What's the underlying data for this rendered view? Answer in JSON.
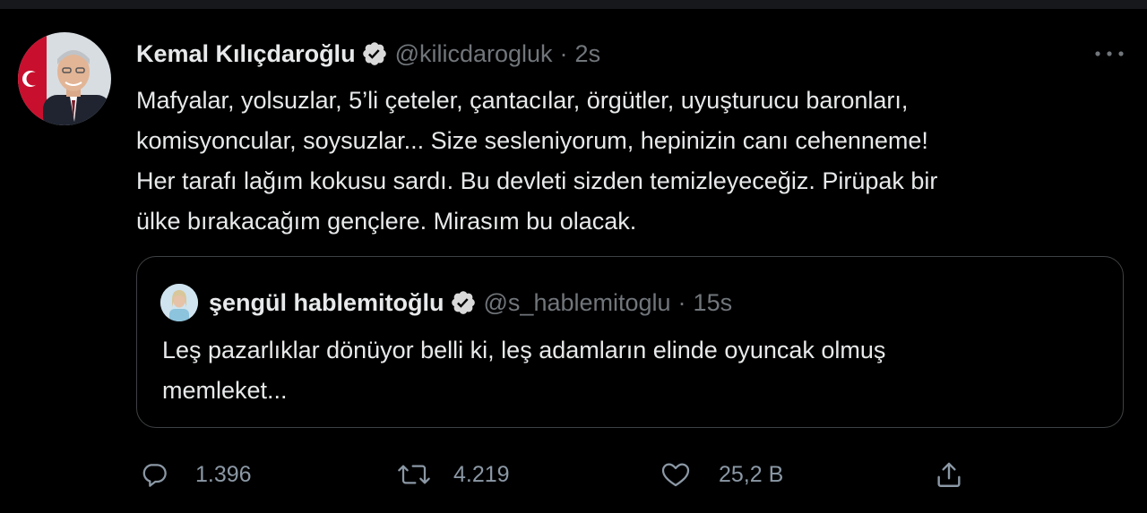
{
  "tweet": {
    "author_name": "Kemal Kılıçdaroğlu",
    "handle": "@kilicdarogluk",
    "separator": "·",
    "time": "2s",
    "text_lines": [
      "Mafyalar, yolsuzlar, 5’li çeteler, çantacılar, örgütler, uyuşturucu baronları,",
      "komisyoncular, soysuzlar... Size sesleniyorum, hepinizin canı cehenneme!",
      "Her tarafı lağım kokusu sardı. Bu devleti sizden temizleyeceğiz. Pirüpak bir",
      "ülke bırakacağım gençlere. Mirasım bu olacak."
    ],
    "icons": {
      "verified": "verified-badge-icon",
      "more": "more-dots-icon"
    }
  },
  "quote": {
    "author_name": "şengül hablemitoğlu",
    "handle": "@s_hablemitoglu",
    "separator": "·",
    "time": "15s",
    "text_lines": [
      "Leş pazarlıklar dönüyor belli ki, leş adamların elinde oyuncak olmuş",
      "memleket..."
    ]
  },
  "actions": {
    "reply_count": "1.396",
    "retweet_count": "4.219",
    "like_count": "25,2 B",
    "icons": [
      "reply-icon",
      "retweet-icon",
      "like-icon",
      "share-icon"
    ]
  },
  "colors": {
    "background": "#000000",
    "text_primary": "#e7e9ea",
    "text_secondary": "#71767b",
    "border": "#3e4144",
    "verified_badge": "#d9d9d9"
  }
}
